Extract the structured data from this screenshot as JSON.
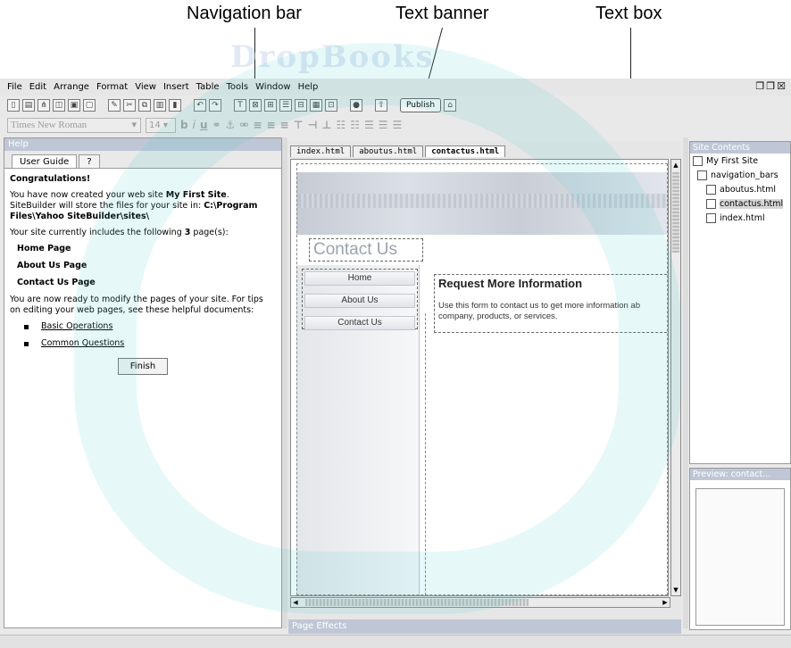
{
  "callouts": {
    "navigation_bar": "Navigation bar",
    "text_banner": "Text banner",
    "text_box": "Text box"
  },
  "watermark": "DropBooks",
  "menu": {
    "items": [
      "File",
      "Edit",
      "Arrange",
      "Format",
      "View",
      "Insert",
      "Table",
      "Tools",
      "Window",
      "Help"
    ],
    "window_controls": "❐❐☒"
  },
  "toolbar": {
    "publish_label": "Publish",
    "font": "Times New Roman",
    "size": "14",
    "bold": "b",
    "italic": "i",
    "underline": "u"
  },
  "help": {
    "title": "Help",
    "tab_user_guide": "User Guide",
    "tab_help_icon": "?",
    "congrats": "Congratulations!",
    "created_prefix": "You have now created your web site ",
    "site_name": "My First Site",
    "created_suffix": ".",
    "store_prefix": "SiteBuilder will store the files for your site in: ",
    "path": "C:\\Program Files\\Yahoo SiteBuilder\\sites\\",
    "includes_prefix": "Your site currently includes the following ",
    "page_count": "3",
    "includes_suffix": " page(s):",
    "pages": [
      "Home Page",
      "About Us Page",
      "Contact Us Page"
    ],
    "ready_text": "You are now ready to modify the pages of your site. For tips on editing your web pages, see these helpful documents:",
    "links": [
      "Basic Operations",
      "Common Questions"
    ],
    "finish_label": "Finish"
  },
  "editor": {
    "tabs": [
      "index.html",
      "aboutus.html",
      "contactus.html"
    ],
    "active_tab": "contactus.html",
    "banner_text": "Contact Us",
    "nav_buttons": [
      "Home",
      "About Us",
      "Contact Us"
    ],
    "textbox_heading": "Request More Information",
    "textbox_body_line1": "Use this form to contact us to get more information ab",
    "textbox_body_line2": "company, products, or services.",
    "page_effects": "Page Effects"
  },
  "site_contents": {
    "title": "Site Contents",
    "tree": [
      "My First Site",
      "navigation_bars",
      "aboutus.html",
      "contactus.html",
      "index.html"
    ],
    "selected": "contactus.html"
  },
  "preview": {
    "title": "Preview: contact..."
  }
}
